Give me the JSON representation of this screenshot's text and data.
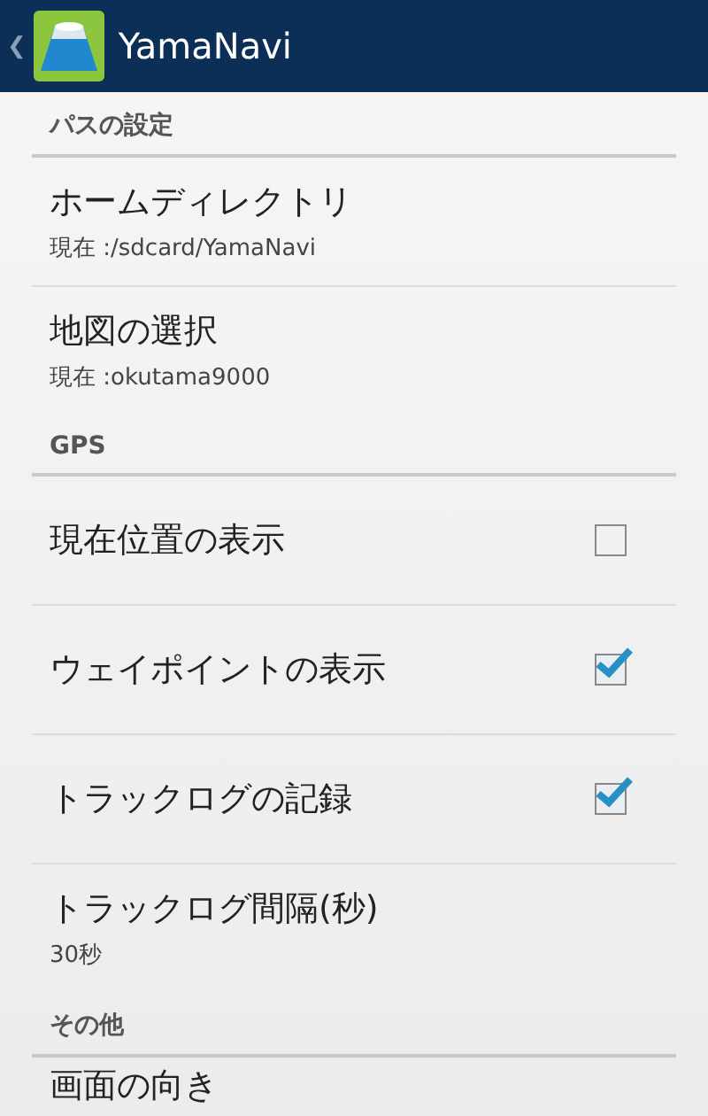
{
  "app_bar": {
    "back": "❮",
    "title": "YamaNavi"
  },
  "sections": [
    {
      "title": "パスの設定",
      "items": [
        {
          "kind": "text",
          "title": "ホームディレクトリ",
          "summary": "現在 :/sdcard/YamaNavi"
        },
        {
          "kind": "text",
          "title": "地図の選択",
          "summary": "現在 :okutama9000"
        }
      ]
    },
    {
      "title": "GPS",
      "items": [
        {
          "kind": "checkbox",
          "title": "現在位置の表示",
          "checked": false
        },
        {
          "kind": "checkbox",
          "title": "ウェイポイントの表示",
          "checked": true
        },
        {
          "kind": "checkbox",
          "title": "トラックログの記録",
          "checked": true
        },
        {
          "kind": "text",
          "title": "トラックログ間隔(秒)",
          "summary": "30秒"
        }
      ]
    },
    {
      "title": "その他",
      "items": [
        {
          "kind": "text",
          "title": "画面の向き"
        }
      ]
    }
  ]
}
